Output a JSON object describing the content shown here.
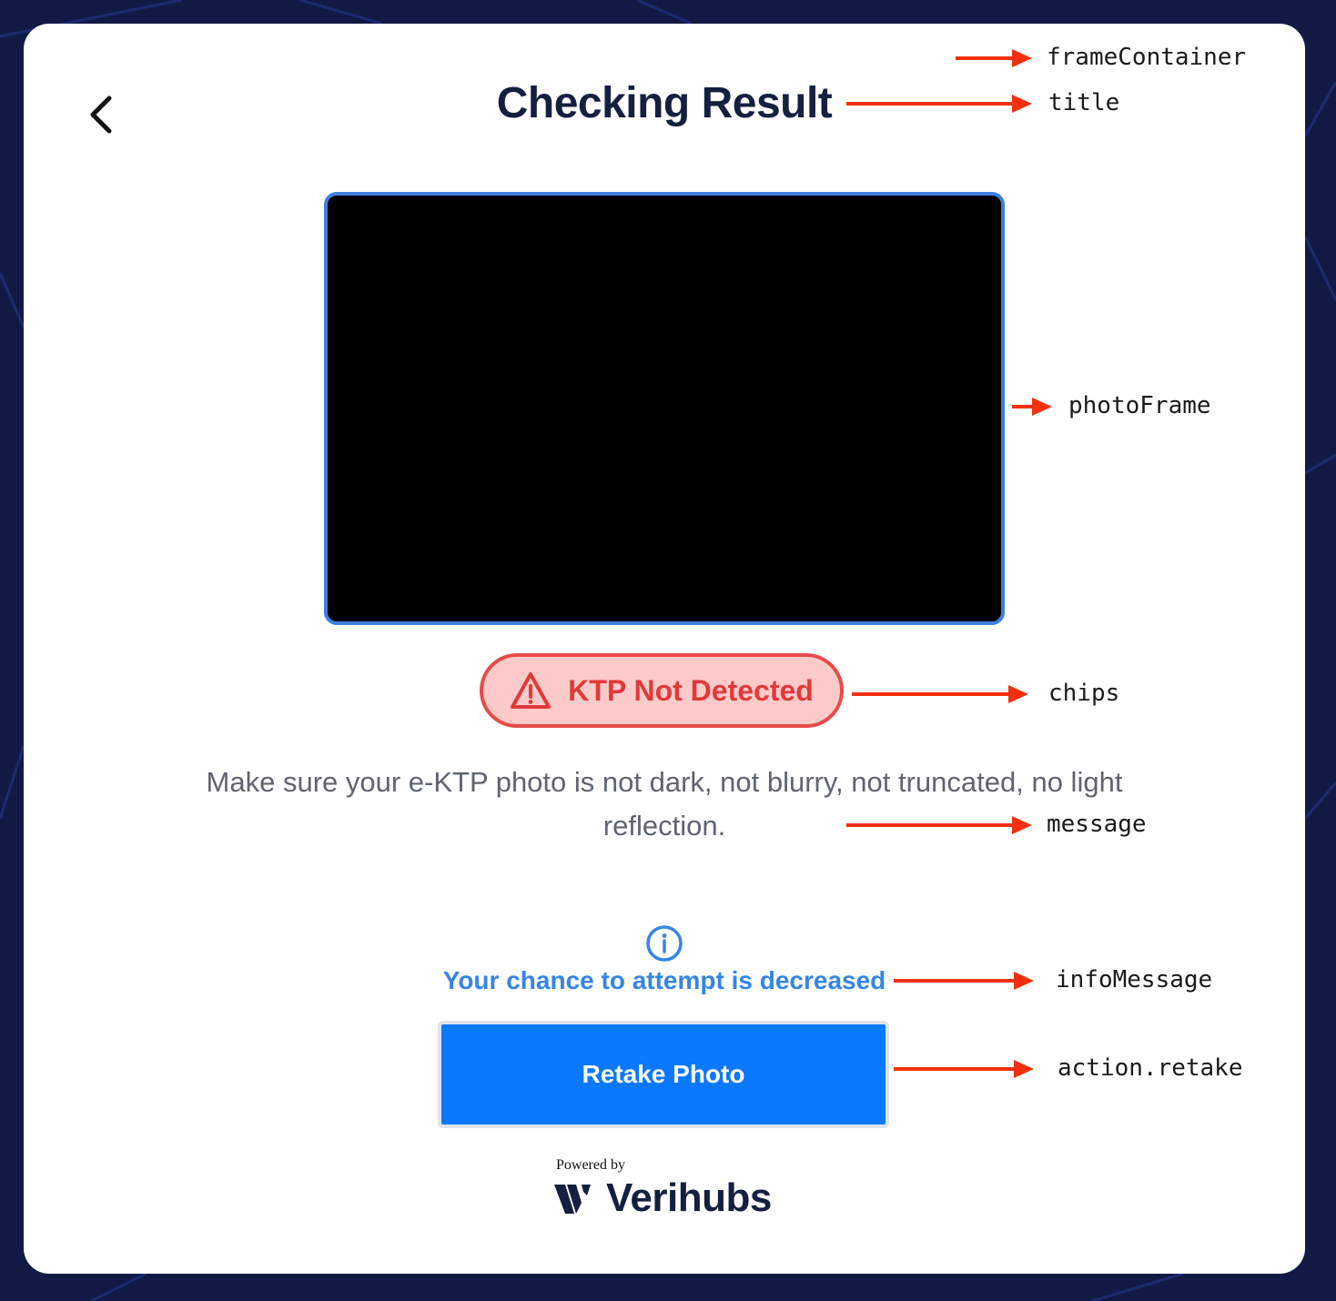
{
  "screen": {
    "back_icon": "chevron-left-icon",
    "title": "Checking Result",
    "chip": {
      "icon": "warning-triangle-icon",
      "label": "KTP Not Detected",
      "bg_color": "#fdcaca",
      "border_color": "#e84a4a",
      "text_color": "#e03a3a"
    },
    "message": "Make sure your e-KTP photo is not dark, not blurry, not truncated, no light reflection.",
    "info": {
      "icon": "info-circle-icon",
      "text": "Your chance to attempt is decreased",
      "color": "#3585e8"
    },
    "retake_button": {
      "label": "Retake Photo",
      "color": "#0a78ff"
    },
    "footer": {
      "powered_by": "Powered by",
      "brand_icon": "verihubs-logo-icon",
      "brand": "Verihubs"
    }
  },
  "annotations": {
    "arrow_color": "#f2300f",
    "labels": {
      "frame_container": "frameContainer",
      "title": "title",
      "photo_frame": "photoFrame",
      "chips": "chips",
      "message": "message",
      "info_message": "infoMessage",
      "action_retake": "action.retake"
    }
  }
}
